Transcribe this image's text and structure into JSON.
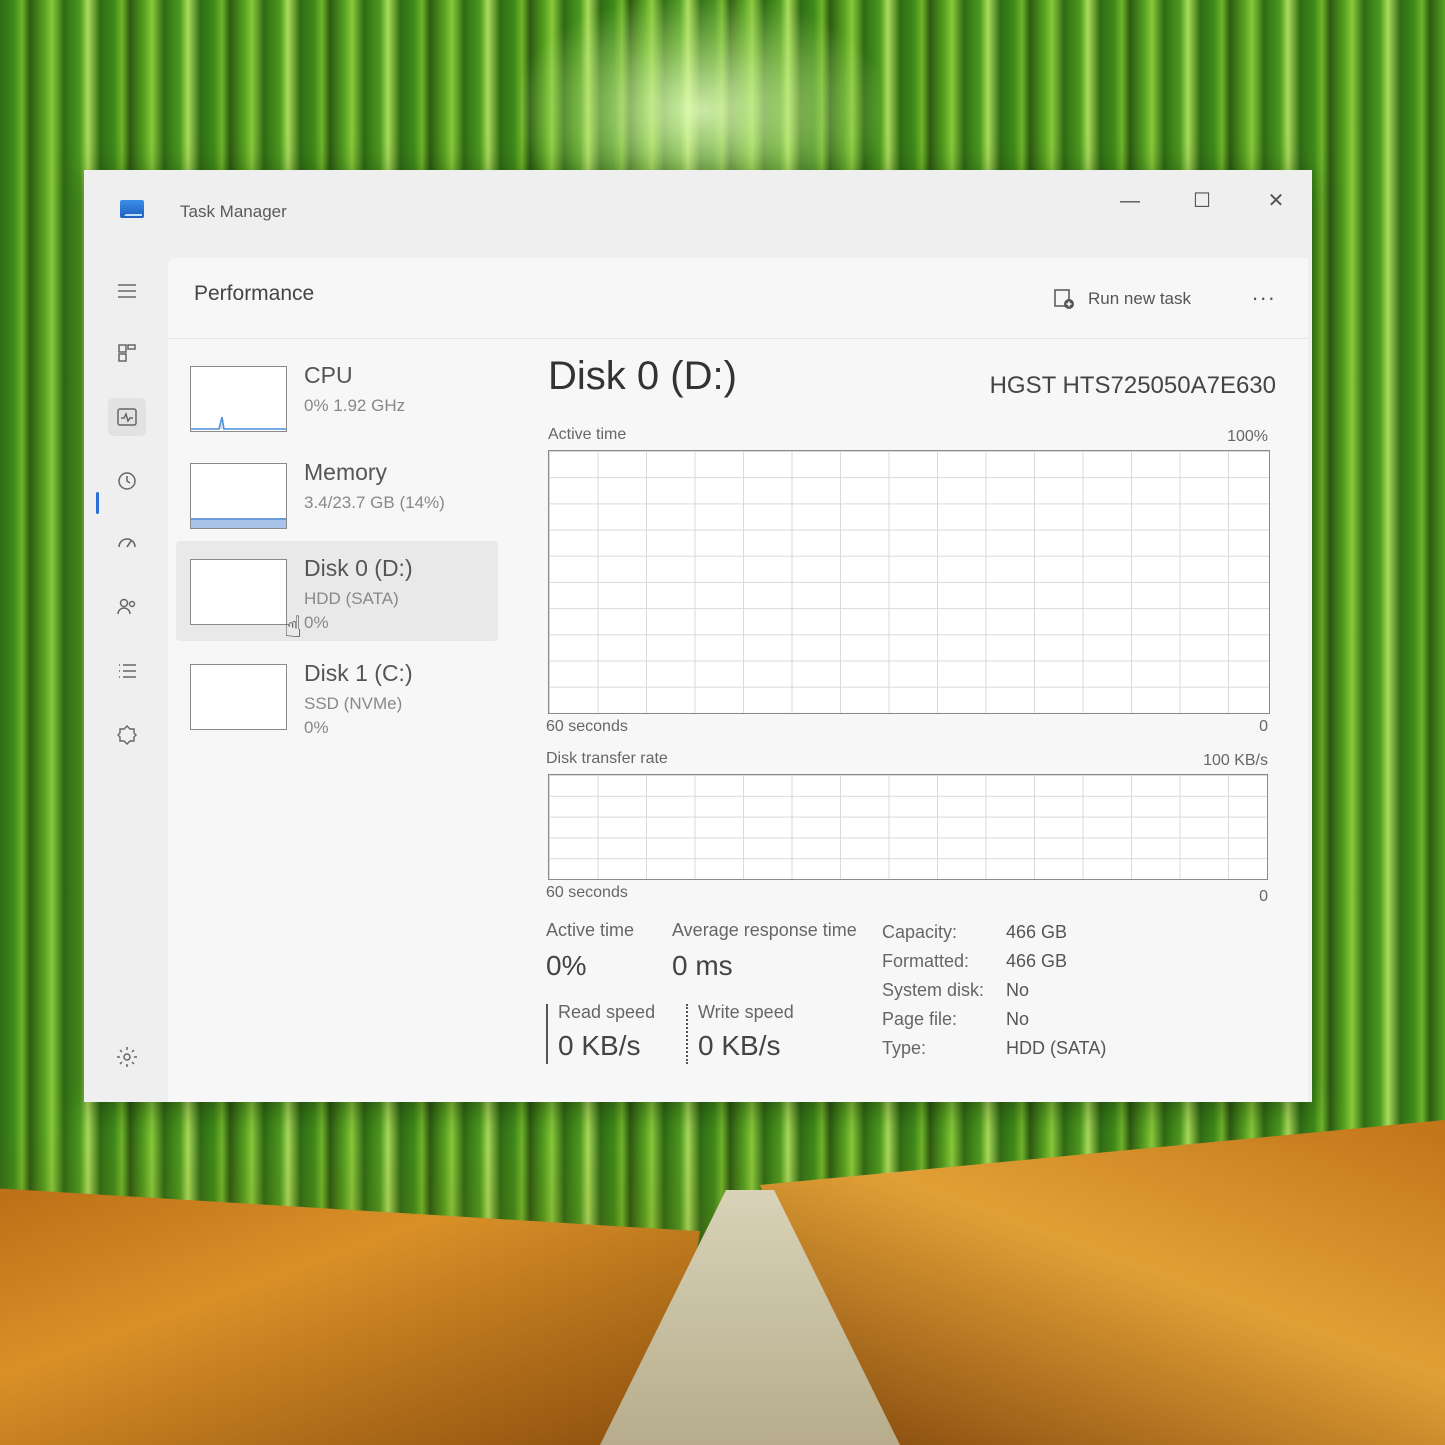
{
  "window": {
    "title": "Task Manager",
    "minimize": "—",
    "maximize": "☐",
    "close": "✕"
  },
  "nav": {
    "items": [
      {
        "icon": "hamburger-icon"
      },
      {
        "icon": "processes-icon"
      },
      {
        "icon": "performance-icon"
      },
      {
        "icon": "app-history-icon"
      },
      {
        "icon": "startup-apps-icon"
      },
      {
        "icon": "users-icon"
      },
      {
        "icon": "details-icon"
      },
      {
        "icon": "services-icon"
      },
      {
        "icon": "settings-icon"
      }
    ]
  },
  "header": {
    "title": "Performance",
    "run_new_task": "Run new task",
    "more": "..."
  },
  "devices": [
    {
      "name": "CPU",
      "sub": "0%  1.92 GHz",
      "sub2": ""
    },
    {
      "name": "Memory",
      "sub": "3.4/23.7 GB (14%)",
      "sub2": ""
    },
    {
      "name": "Disk 0 (D:)",
      "sub": "HDD (SATA)",
      "sub2": "0%"
    },
    {
      "name": "Disk 1 (C:)",
      "sub": "SSD (NVMe)",
      "sub2": "0%"
    }
  ],
  "detail": {
    "title": "Disk 0 (D:)",
    "model": "HGST HTS725050A7E630",
    "graph1": {
      "label": "Active time",
      "max": "100%",
      "time": "60 seconds",
      "min": "0"
    },
    "graph2": {
      "label": "Disk transfer rate",
      "max": "100 KB/s",
      "time": "60 seconds",
      "min": "0"
    },
    "stats": {
      "active_time_label": "Active time",
      "active_time_value": "0%",
      "avg_response_label": "Average response time",
      "avg_response_value": "0 ms",
      "read_speed_label": "Read speed",
      "read_speed_value": "0 KB/s",
      "write_speed_label": "Write speed",
      "write_speed_value": "0 KB/s"
    },
    "properties": [
      {
        "label": "Capacity:",
        "value": "466 GB"
      },
      {
        "label": "Formatted:",
        "value": "466 GB"
      },
      {
        "label": "System disk:",
        "value": "No"
      },
      {
        "label": "Page file:",
        "value": "No"
      },
      {
        "label": "Type:",
        "value": "HDD (SATA)"
      }
    ]
  },
  "colors": {
    "accent": "#2b6fd6",
    "memory_fill": "#a9c4e8",
    "cpu_spike": "#4a8fd8"
  }
}
